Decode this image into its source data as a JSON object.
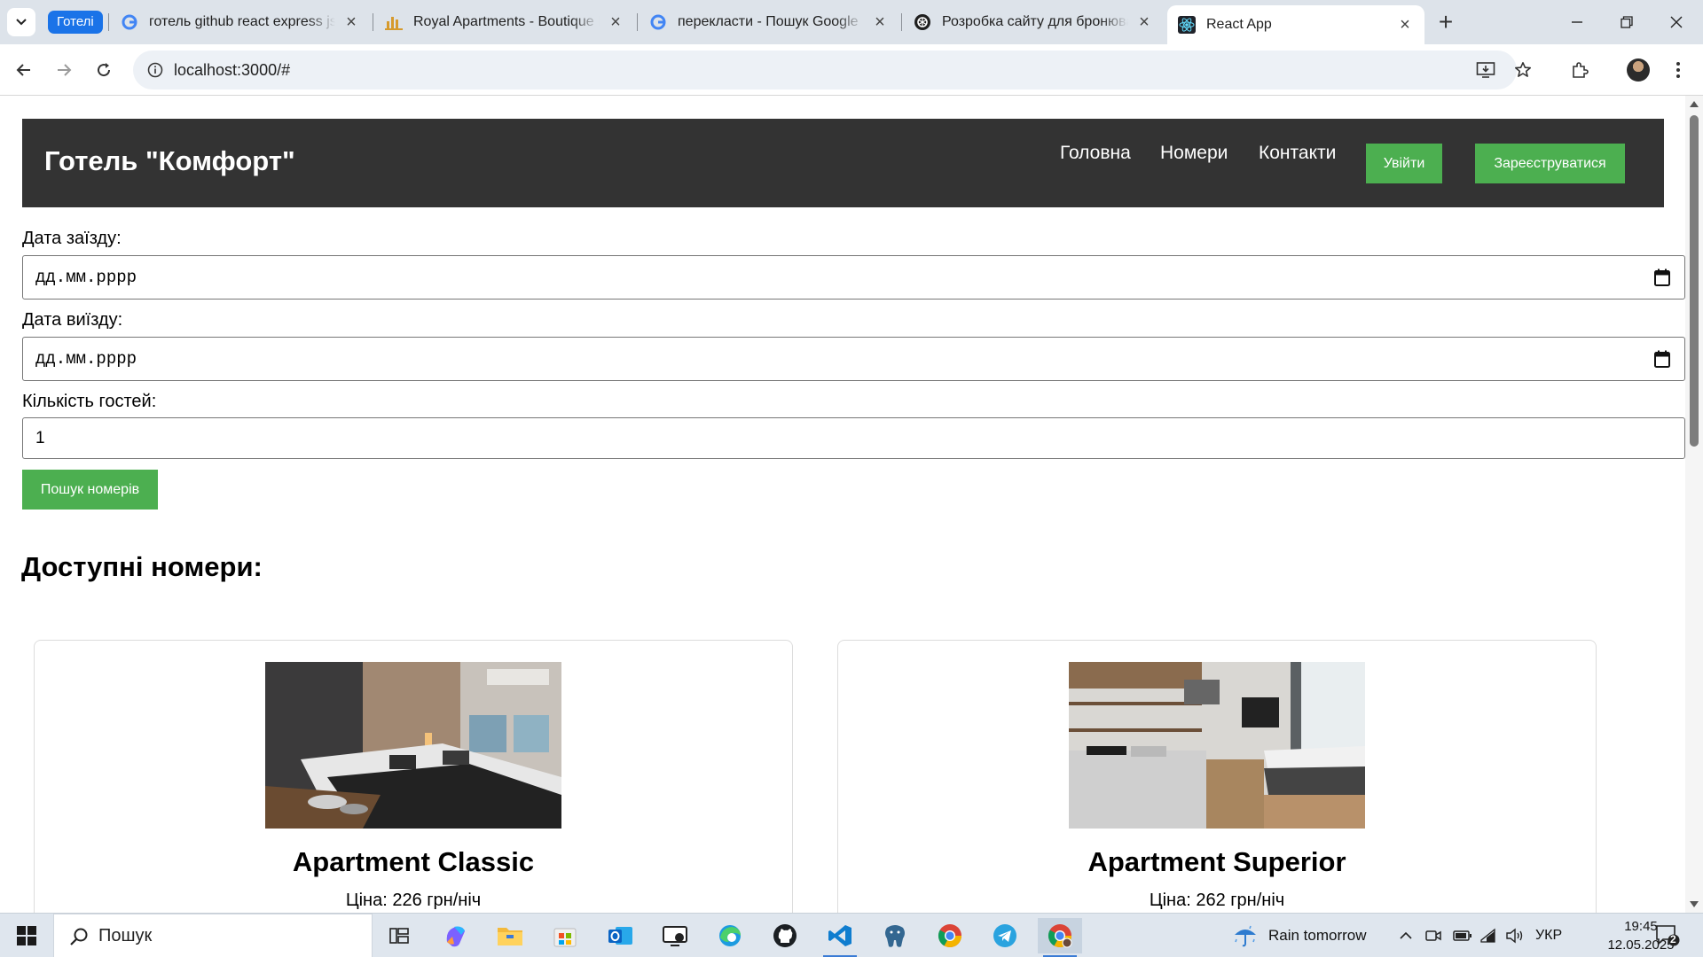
{
  "browser": {
    "tab_group_label": "Готелі",
    "tabs": [
      {
        "title": "готель github react express js p",
        "favicon": "google-icon"
      },
      {
        "title": "Royal Apartments - Boutique Re",
        "favicon": "royal-apartments-icon"
      },
      {
        "title": "перекласти - Пошук Google",
        "favicon": "google-icon"
      },
      {
        "title": "Розробка сайту для бронюван",
        "favicon": "chatgpt-icon"
      },
      {
        "title": "React App",
        "favicon": "react-icon",
        "active": true
      }
    ],
    "url": "localhost:3000/#"
  },
  "site": {
    "brand": "Готель \"Комфорт\"",
    "nav": [
      "Головна",
      "Номери",
      "Контакти"
    ],
    "login_label": "Увійти",
    "register_label": "Зареєструватися",
    "colors": {
      "header_bg": "#333333",
      "accent": "#4caf50"
    }
  },
  "booking": {
    "checkin_label": "Дата заїзду:",
    "checkin_value": "дд.мм.рррр",
    "checkout_label": "Дата виїзду:",
    "checkout_value": "дд.мм.рррр",
    "guests_label": "Кількість гостей:",
    "guests_value": "1",
    "search_label": "Пошук номерів"
  },
  "rooms": {
    "title": "Доступні номери:",
    "items": [
      {
        "name": "Apartment Classic",
        "price": "Ціна: 226 грн/ніч"
      },
      {
        "name": "Apartment Superior",
        "price": "Ціна: 262 грн/ніч"
      }
    ]
  },
  "taskbar": {
    "search_placeholder": "Пошук",
    "weather": "Rain tomorrow",
    "language": "УКР",
    "time": "19:45",
    "date": "12.05.2025",
    "notifications": "2"
  }
}
